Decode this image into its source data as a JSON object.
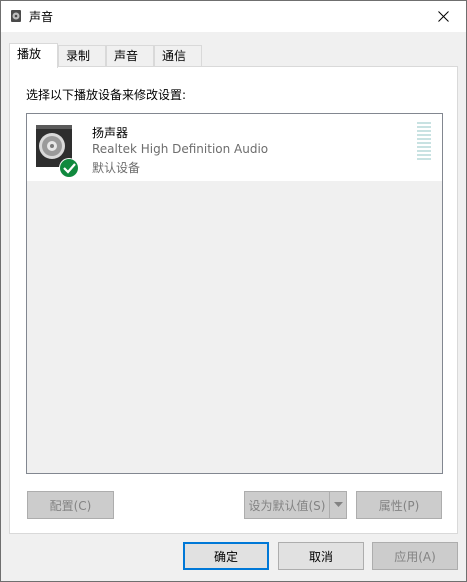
{
  "window": {
    "title": "声音",
    "title_icon": "speaker-small-icon",
    "close_icon": "close-icon"
  },
  "tabs": [
    {
      "label": "播放",
      "active": true
    },
    {
      "label": "录制",
      "active": false
    },
    {
      "label": "声音",
      "active": false
    },
    {
      "label": "通信",
      "active": false
    }
  ],
  "panel": {
    "instruction": "选择以下播放设备来修改设置:",
    "devices": [
      {
        "name": "扬声器",
        "driver": "Realtek High Definition Audio",
        "status": "默认设备",
        "icon": "speaker-icon",
        "badge_icon": "checkmark-icon"
      }
    ]
  },
  "panel_buttons": {
    "configure": "配置(C)",
    "set_default": "设为默认值(S)",
    "properties": "属性(P)"
  },
  "dialog_buttons": {
    "ok": "确定",
    "cancel": "取消",
    "apply": "应用(A)"
  },
  "colors": {
    "accent": "#0078d7",
    "check_badge": "#10893e",
    "level_meter": "#c8e2e2"
  }
}
